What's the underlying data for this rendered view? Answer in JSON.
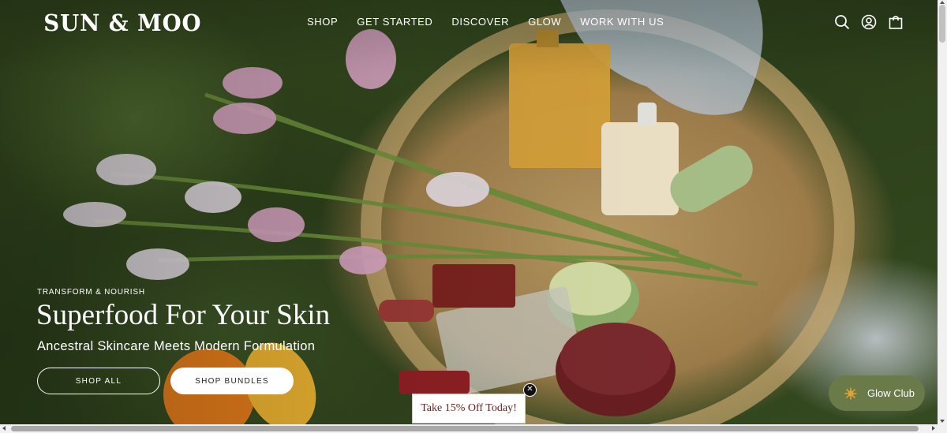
{
  "brand": {
    "logo": "SUN & MOO"
  },
  "nav": {
    "items": [
      "SHOP",
      "GET STARTED",
      "DISCOVER",
      "GLOW",
      "WORK WITH US"
    ]
  },
  "header_icons": [
    "search-icon",
    "account-icon",
    "cart-icon"
  ],
  "hero": {
    "eyebrow": "TRANSFORM & NOURISH",
    "headline": "Superfood For Your Skin",
    "subheadline": "Ancestral Skincare Meets Modern Formulation",
    "primary_button": "SHOP ALL",
    "secondary_button": "SHOP BUNDLES"
  },
  "promo": {
    "label": "Take 15% Off Today!",
    "close_icon": "close-icon"
  },
  "rewards": {
    "label": "Glow Club",
    "icon": "sun-icon"
  },
  "colors": {
    "promo_text": "#6b1d1d",
    "rewards_bg": "#6a7a48",
    "rewards_icon": "#e0a233"
  }
}
